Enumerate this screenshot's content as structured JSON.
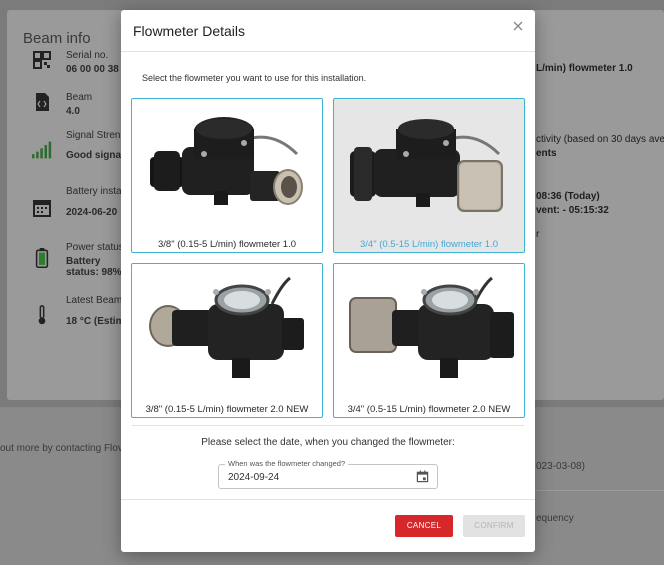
{
  "background": {
    "section_title": "Beam info",
    "rows": [
      {
        "label": "Serial no.",
        "value": "06 00 00 38",
        "icon": "qr-code-icon"
      },
      {
        "label": "Beam",
        "value": "4.0",
        "icon": "code-file-icon"
      },
      {
        "label": "Signal Stren",
        "value": "Good signa",
        "icon": "signal-bars-icon"
      },
      {
        "label": "Battery insta",
        "value": "2024-06-20",
        "icon": "calendar-icon"
      },
      {
        "label": "Power status",
        "value": "Battery",
        "value2": "status: 98%",
        "icon": "battery-icon"
      },
      {
        "label": "Latest Beam",
        "value": "18 °C (Estim",
        "icon": "thermometer-icon"
      }
    ],
    "right_texts": {
      "flowmeter": "L/min) flowmeter 1.0",
      "activity": "ctivity (based on 30 days ave",
      "events": "ents",
      "time_today": "08:36 (Today)",
      "event_time": "vent: - 05:15:32",
      "r": "r"
    },
    "lower_texts": {
      "contact": "out more by contacting Flov",
      "date": "023-03-08)",
      "frequency": "equency"
    }
  },
  "modal": {
    "title": "Flowmeter Details",
    "instruction": "Select the flowmeter you want to use for this installation.",
    "options": [
      {
        "label": "3/8\" (0.15-5 L/min) flowmeter 1.0",
        "selected": false
      },
      {
        "label": "3/4\" (0.5-15 L/min) flowmeter 1.0",
        "selected": true
      },
      {
        "label": "3/8\" (0.15-5 L/min) flowmeter 2.0 NEW",
        "selected": false
      },
      {
        "label": "3/4\" (0.5-15 L/min) flowmeter 2.0 NEW",
        "selected": false
      }
    ],
    "date_prompt": "Please select the date, when you changed the flowmeter:",
    "date_field": {
      "label": "When was the flowmeter changed?",
      "value": "2024-09-24"
    },
    "cancel_label": "CANCEL",
    "confirm_label": "CONFIRM"
  },
  "colors": {
    "accent": "#3fb3d6",
    "cancel": "#d6282a",
    "disabled": "#e2e2e2"
  }
}
